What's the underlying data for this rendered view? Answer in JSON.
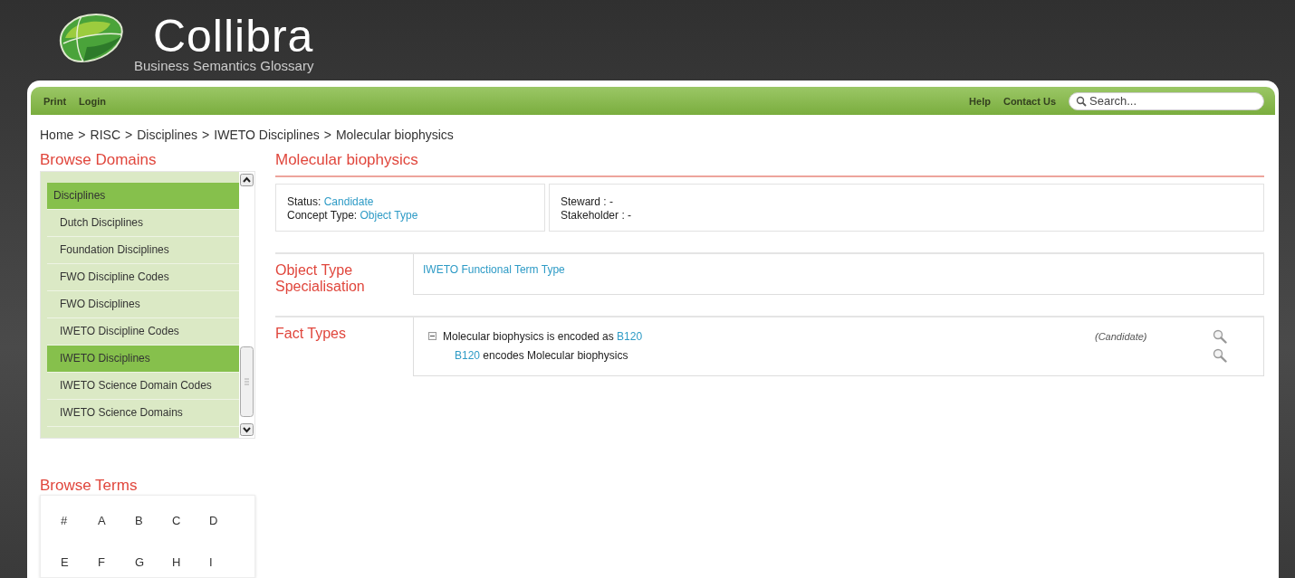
{
  "logo": {
    "name": "Collibra",
    "tagline": "Business Semantics Glossary"
  },
  "toolbar": {
    "left_links": [
      "Print",
      "Login"
    ],
    "right_links": [
      "Help",
      "Contact Us"
    ],
    "search": {
      "placeholder": "Search..."
    }
  },
  "breadcrumb": {
    "separator": ">",
    "items": [
      "Home",
      "RISC",
      "Disciplines",
      "IWETO Disciplines",
      "Molecular biophysics"
    ]
  },
  "browse_domains": {
    "title": "Browse Domains",
    "items": [
      {
        "label": "Disciplines",
        "selected": true,
        "children": [
          {
            "label": "Dutch Disciplines",
            "selected": false
          },
          {
            "label": "Foundation Disciplines",
            "selected": false
          },
          {
            "label": "FWO Discipline Codes",
            "selected": false
          },
          {
            "label": "FWO Disciplines",
            "selected": false
          },
          {
            "label": "IWETO Discipline Codes",
            "selected": false
          },
          {
            "label": "IWETO Disciplines",
            "selected": true
          },
          {
            "label": "IWETO Science Domain Codes",
            "selected": false
          },
          {
            "label": "IWETO Science Domains",
            "selected": false
          }
        ]
      }
    ]
  },
  "browse_terms": {
    "title": "Browse Terms",
    "letters": [
      "#",
      "A",
      "B",
      "C",
      "D",
      "E",
      "F",
      "G",
      "H",
      "I"
    ]
  },
  "term": {
    "title": "Molecular biophysics",
    "info_left": [
      {
        "label": "Status:",
        "value": "Candidate"
      },
      {
        "label": "Concept Type:",
        "value": "Object Type"
      }
    ],
    "info_right": [
      {
        "label": "Steward : -"
      },
      {
        "label": "Stakeholder : -"
      }
    ],
    "specialisation": {
      "title": "Object Type Specialisation",
      "value": "IWETO Functional Term Type"
    },
    "fact_types": {
      "title": "Fact Types",
      "expanded": true,
      "rows": [
        {
          "segments": [
            {
              "text": "Molecular biophysics is encoded as ",
              "link": false
            },
            {
              "text": "B120",
              "link": true
            }
          ],
          "status": "(Candidate)"
        },
        {
          "segments": [
            {
              "text": "B120",
              "link": true
            },
            {
              "text": " encodes Molecular biophysics",
              "link": false
            }
          ]
        }
      ]
    }
  }
}
